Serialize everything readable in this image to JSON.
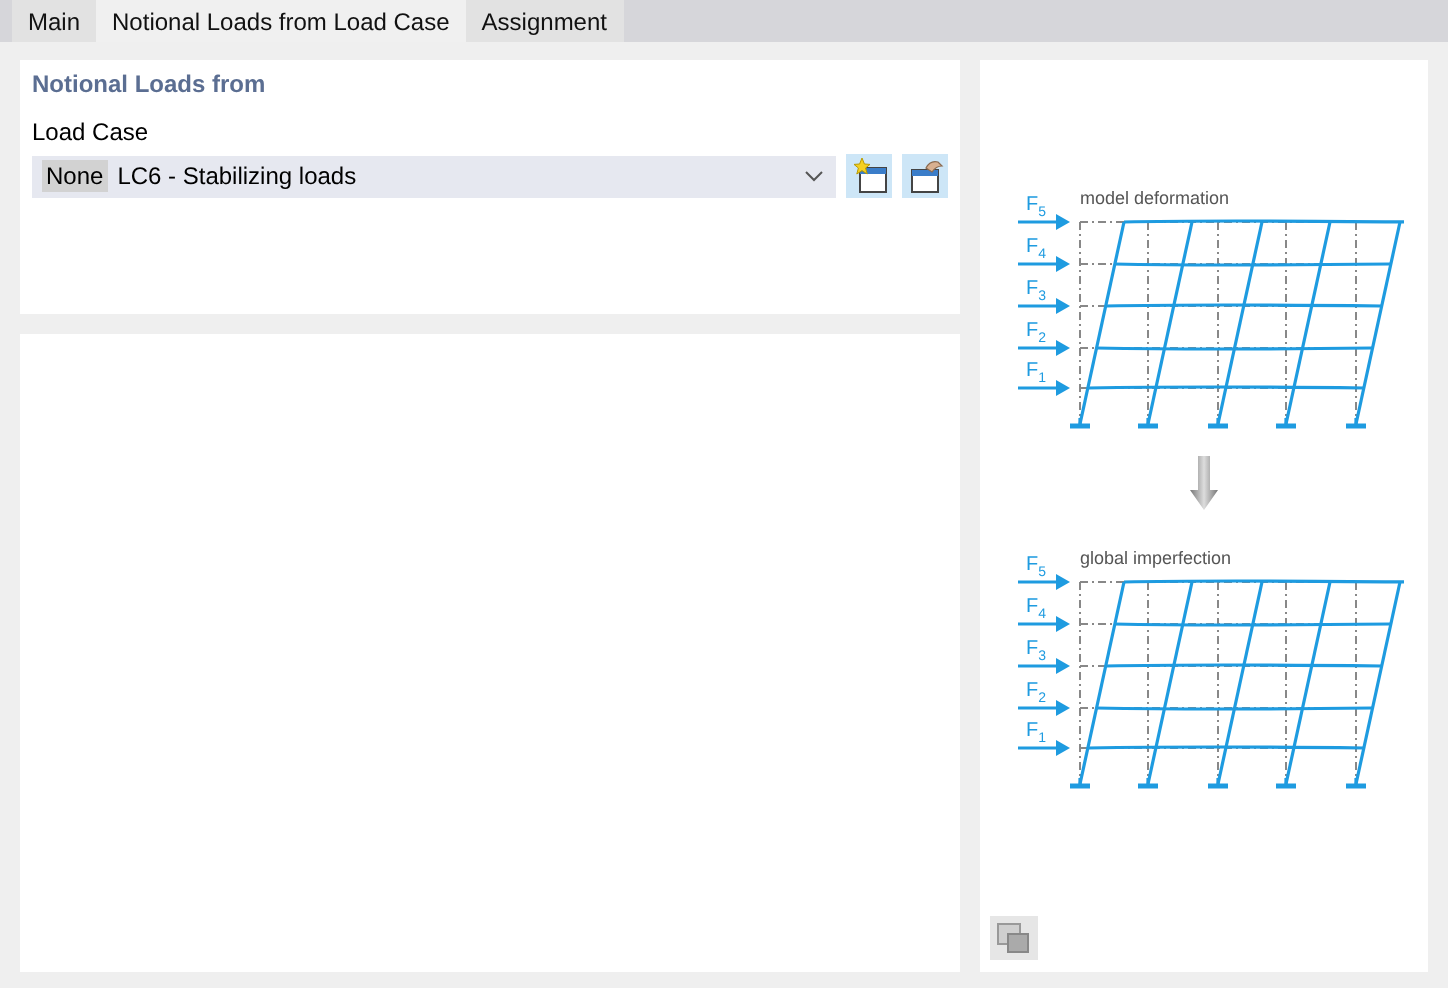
{
  "tabs": [
    {
      "label": "Main",
      "selected": false
    },
    {
      "label": "Notional Loads from Load Case",
      "selected": true
    },
    {
      "label": "Assignment",
      "selected": false
    }
  ],
  "section_title": "Notional Loads from",
  "load_case": {
    "label": "Load Case",
    "tag": "None",
    "value": "LC6 - Stabilizing loads"
  },
  "diagrams": [
    {
      "title": "model deformation",
      "loads": [
        "F$_{5}$",
        "F$_{4}$",
        "F$_{3}$",
        "F$_{2}$",
        "F$_{1}$"
      ]
    },
    {
      "title": "global imperfection",
      "loads": [
        "F$_{5}$",
        "F$_{4}$",
        "F$_{3}$",
        "F$_{2}$",
        "F$_{1}$"
      ]
    }
  ]
}
